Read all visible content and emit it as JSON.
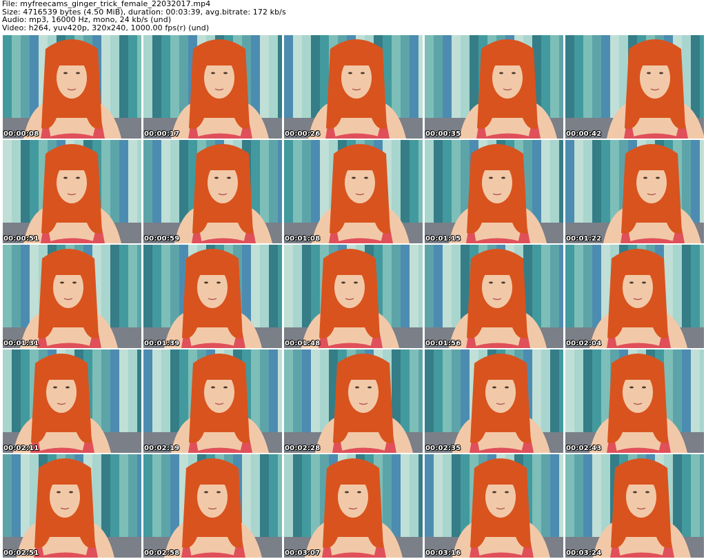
{
  "header": {
    "file_line": "File: myfreecams_ginger_trick_female_22032017.mp4",
    "size_line": "Size: 4716539 bytes (4.50 MiB), duration: 00:03:39, avg.bitrate: 172 kb/s",
    "audio_line": "Audio: mp3, 16000 Hz, mono, 24 kb/s (und)",
    "video_line": "Video: h264, yuv420p, 320x240, 1000.00 fps(r) (und)"
  },
  "colors": {
    "hair": "#d9531e",
    "skin": "#f2c9a8",
    "top": "#e0505a",
    "curtain_teal": "#2e8f94",
    "curtain_light": "#9fd0c8",
    "sofa": "#7a7f88"
  },
  "frames": [
    {
      "timestamp": "00:00:08"
    },
    {
      "timestamp": "00:00:17"
    },
    {
      "timestamp": "00:00:26"
    },
    {
      "timestamp": "00:00:35"
    },
    {
      "timestamp": "00:00:42"
    },
    {
      "timestamp": "00:00:51"
    },
    {
      "timestamp": "00:00:59"
    },
    {
      "timestamp": "00:01:08"
    },
    {
      "timestamp": "00:01:15"
    },
    {
      "timestamp": "00:01:22"
    },
    {
      "timestamp": "00:01:31"
    },
    {
      "timestamp": "00:01:39"
    },
    {
      "timestamp": "00:01:48"
    },
    {
      "timestamp": "00:01:56"
    },
    {
      "timestamp": "00:02:04"
    },
    {
      "timestamp": "00:02:11"
    },
    {
      "timestamp": "00:02:19"
    },
    {
      "timestamp": "00:02:28"
    },
    {
      "timestamp": "00:02:35"
    },
    {
      "timestamp": "00:02:43"
    },
    {
      "timestamp": "00:02:51"
    },
    {
      "timestamp": "00:02:58"
    },
    {
      "timestamp": "00:03:07"
    },
    {
      "timestamp": "00:03:16"
    },
    {
      "timestamp": "00:03:24"
    }
  ]
}
